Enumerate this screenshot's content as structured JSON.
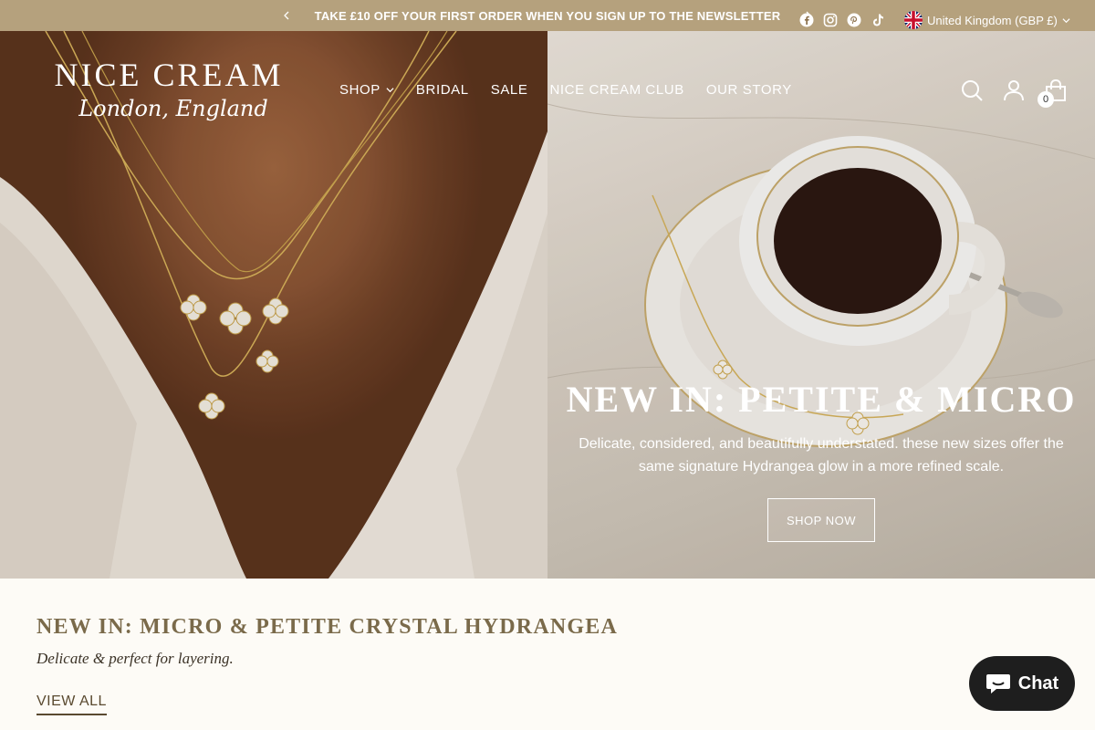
{
  "announcement": {
    "text": "TAKE £10 OFF YOUR FIRST ORDER WHEN YOU SIGN UP TO THE NEWSLETTER",
    "prev_icon": "chevron-left-icon",
    "next_icon": "chevron-right-icon"
  },
  "header": {
    "logo_main": "NICE CREAM",
    "logo_sub": "London, England",
    "nav": [
      {
        "label": "SHOP",
        "has_dropdown": true
      },
      {
        "label": "BRIDAL"
      },
      {
        "label": "SALE"
      },
      {
        "label": "NICE CREAM CLUB"
      },
      {
        "label": "OUR STORY"
      }
    ],
    "social": [
      "facebook-icon",
      "instagram-icon",
      "pinterest-icon",
      "tiktok-icon"
    ],
    "locale": "United Kingdom (GBP £)",
    "cart_count": "0",
    "icons": [
      "search-icon",
      "account-icon",
      "cart-icon"
    ]
  },
  "hero": {
    "title": "NEW IN: PETITE & MICRO",
    "subtitle": "Delicate, considered, and beautifully understated. these new sizes offer the same signature Hydrangea glow in a more refined scale.",
    "button": "SHOP NOW"
  },
  "section": {
    "title": "NEW IN: MICRO & PETITE CRYSTAL HYDRANGEA",
    "subtitle": "Delicate & perfect for layering.",
    "link": "VIEW ALL"
  },
  "chat": {
    "label": "Chat"
  },
  "colors": {
    "announcement_bg": "#b5a17d",
    "heading_gold": "#7a6a4a",
    "chat_bg": "#1e1e1e"
  }
}
